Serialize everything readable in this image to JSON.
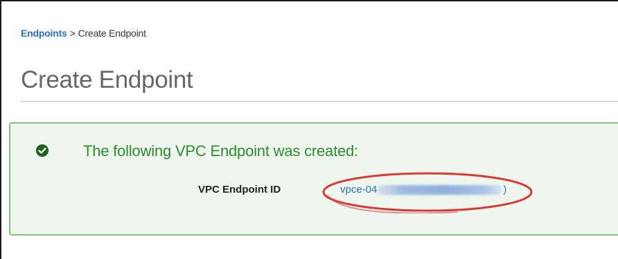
{
  "breadcrumb": {
    "parent_label": "Endpoints",
    "separator": ">",
    "current_label": "Create Endpoint"
  },
  "page": {
    "title": "Create Endpoint"
  },
  "alert": {
    "type": "success",
    "icon": "check-circle-icon",
    "message": "The following VPC Endpoint was created:",
    "field_label": "VPC Endpoint ID",
    "endpoint_id_visible_prefix": "vpce-04",
    "endpoint_id_visible_suffix": ")",
    "endpoint_id_redacted": true
  },
  "annotation": {
    "type": "red-ellipse-highlight"
  },
  "colors": {
    "link": "#2c6fbd",
    "success_text": "#2e8b2e",
    "success_border": "#7fc47f",
    "success_bg": "#eef6ee",
    "annotation_red": "#d83a3a",
    "title_gray": "#666666"
  }
}
